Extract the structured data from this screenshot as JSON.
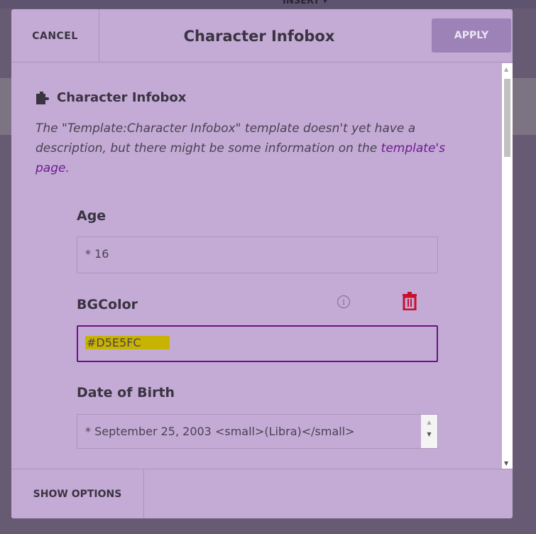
{
  "background": {
    "toolbar_insert": "INSERT ▾"
  },
  "dialog": {
    "cancel_label": "CANCEL",
    "title": "Character Infobox",
    "apply_label": "APPLY",
    "template_name": "Character Infobox",
    "description_before": "The \"Template:Character Infobox\" template doesn't yet have a description, but there might be some information on the ",
    "description_link": "template's page",
    "description_after": ".",
    "fields": [
      {
        "label": "Age",
        "value": "* 16"
      },
      {
        "label": "BGColor",
        "value": "#D5E5FC"
      },
      {
        "label": "Date of Birth",
        "value": "* September 25, 2003 <small>(Libra)</small>"
      }
    ],
    "show_options_label": "SHOW OPTIONS"
  },
  "colors": {
    "accent": "#6a1580",
    "highlight": "#c7b400",
    "delete": "#c8102e",
    "apply_bg": "#9c82b7"
  }
}
